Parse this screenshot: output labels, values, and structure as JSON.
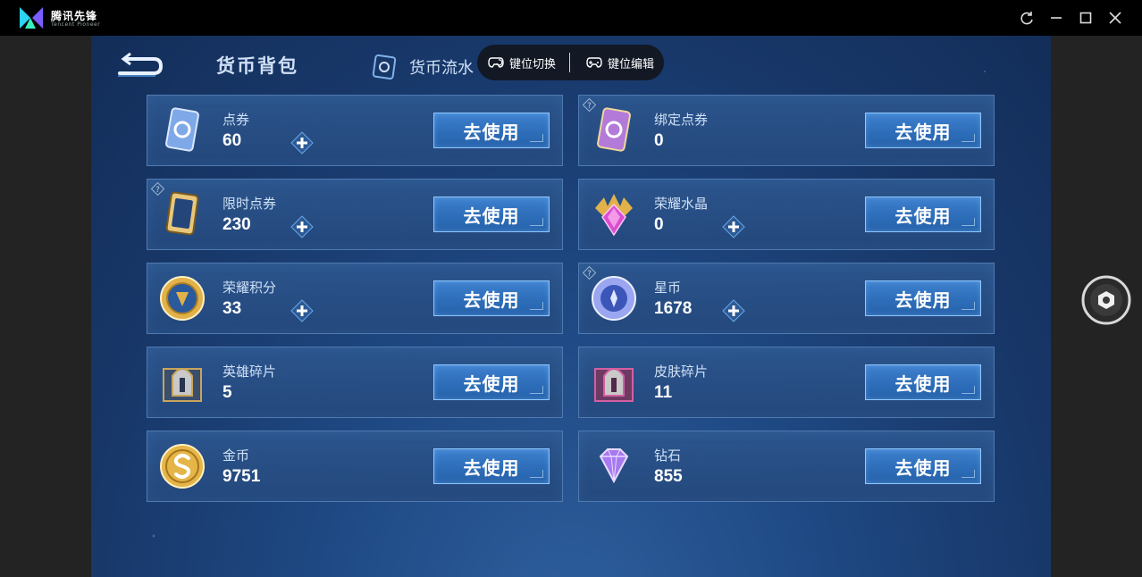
{
  "window": {
    "app_name": "腾讯先锋",
    "app_subtitle": "Tencent Pioneer",
    "controls": [
      "refresh-icon",
      "minimize-icon",
      "maximize-icon",
      "close-icon"
    ]
  },
  "header": {
    "title": "货币背包",
    "flow_tab": "货币流水",
    "key_switch": "键位切换",
    "key_edit": "键位编辑"
  },
  "currencies": [
    {
      "id": "coupon",
      "name": "点券",
      "amount": "60",
      "plus": true,
      "help": false,
      "button": "去使用",
      "icon": "coupon-card-icon",
      "color": "#7fa8e8"
    },
    {
      "id": "bound-coupon",
      "name": "绑定点券",
      "amount": "0",
      "plus": false,
      "help": true,
      "button": "去使用",
      "icon": "bound-coupon-card-icon",
      "color": "#b37ad9"
    },
    {
      "id": "limited-coupon",
      "name": "限时点券",
      "amount": "230",
      "plus": true,
      "help": true,
      "button": "去使用",
      "icon": "limited-coupon-card-icon",
      "color": "#e8c77a"
    },
    {
      "id": "glory-crystal",
      "name": "荣耀水晶",
      "amount": "0",
      "plus": true,
      "help": false,
      "button": "去使用",
      "icon": "glory-crystal-icon",
      "color": "#d94fd1"
    },
    {
      "id": "glory-points",
      "name": "荣耀积分",
      "amount": "33",
      "plus": true,
      "help": false,
      "button": "去使用",
      "icon": "glory-points-coin-icon",
      "color": "#e2b24a"
    },
    {
      "id": "star-coin",
      "name": "星币",
      "amount": "1678",
      "plus": true,
      "help": true,
      "button": "去使用",
      "icon": "star-coin-icon",
      "color": "#9aa7f0"
    },
    {
      "id": "hero-shard",
      "name": "英雄碎片",
      "amount": "5",
      "plus": false,
      "help": false,
      "button": "去使用",
      "icon": "hero-shard-helmet-icon",
      "color": "#c9a55a"
    },
    {
      "id": "skin-shard",
      "name": "皮肤碎片",
      "amount": "11",
      "plus": false,
      "help": false,
      "button": "去使用",
      "icon": "skin-shard-helmet-icon",
      "color": "#d45fa0"
    },
    {
      "id": "gold",
      "name": "金币",
      "amount": "9751",
      "plus": false,
      "help": false,
      "button": "去使用",
      "icon": "gold-coin-icon",
      "color": "#e5b548"
    },
    {
      "id": "diamond",
      "name": "钻石",
      "amount": "855",
      "plus": false,
      "help": false,
      "button": "去使用",
      "icon": "diamond-icon",
      "color": "#a77af0"
    }
  ]
}
